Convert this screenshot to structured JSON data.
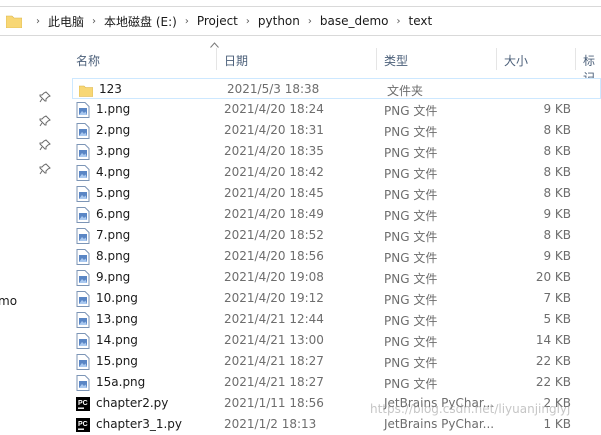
{
  "address": {
    "crumbs": [
      "此电脑",
      "本地磁盘 (E:)",
      "Project",
      "python",
      "base_demo",
      "text"
    ],
    "separator": "›"
  },
  "nav": {
    "partial_label": "mo"
  },
  "header": {
    "name": "名称",
    "date": "日期",
    "type": "类型",
    "size": "大小",
    "tags": "标记"
  },
  "files": [
    {
      "name": "123",
      "date": "2021/5/3 18:38",
      "type": "文件夹",
      "size": "",
      "icon": "folder-icon"
    },
    {
      "name": "1.png",
      "date": "2021/4/20 18:24",
      "type": "PNG 文件",
      "size": "9 KB",
      "icon": "png-file-icon"
    },
    {
      "name": "2.png",
      "date": "2021/4/20 18:31",
      "type": "PNG 文件",
      "size": "8 KB",
      "icon": "png-file-icon"
    },
    {
      "name": "3.png",
      "date": "2021/4/20 18:35",
      "type": "PNG 文件",
      "size": "8 KB",
      "icon": "png-file-icon"
    },
    {
      "name": "4.png",
      "date": "2021/4/20 18:42",
      "type": "PNG 文件",
      "size": "8 KB",
      "icon": "png-file-icon"
    },
    {
      "name": "5.png",
      "date": "2021/4/20 18:45",
      "type": "PNG 文件",
      "size": "8 KB",
      "icon": "png-file-icon"
    },
    {
      "name": "6.png",
      "date": "2021/4/20 18:49",
      "type": "PNG 文件",
      "size": "9 KB",
      "icon": "png-file-icon"
    },
    {
      "name": "7.png",
      "date": "2021/4/20 18:52",
      "type": "PNG 文件",
      "size": "8 KB",
      "icon": "png-file-icon"
    },
    {
      "name": "8.png",
      "date": "2021/4/20 18:56",
      "type": "PNG 文件",
      "size": "9 KB",
      "icon": "png-file-icon"
    },
    {
      "name": "9.png",
      "date": "2021/4/20 19:08",
      "type": "PNG 文件",
      "size": "20 KB",
      "icon": "png-file-icon"
    },
    {
      "name": "10.png",
      "date": "2021/4/20 19:12",
      "type": "PNG 文件",
      "size": "7 KB",
      "icon": "png-file-icon"
    },
    {
      "name": "13.png",
      "date": "2021/4/21 12:44",
      "type": "PNG 文件",
      "size": "5 KB",
      "icon": "png-file-icon"
    },
    {
      "name": "14.png",
      "date": "2021/4/21 13:00",
      "type": "PNG 文件",
      "size": "14 KB",
      "icon": "png-file-icon"
    },
    {
      "name": "15.png",
      "date": "2021/4/21 18:27",
      "type": "PNG 文件",
      "size": "22 KB",
      "icon": "png-file-icon"
    },
    {
      "name": "15a.png",
      "date": "2021/4/21 18:27",
      "type": "PNG 文件",
      "size": "22 KB",
      "icon": "png-file-icon"
    },
    {
      "name": "chapter2.py",
      "date": "2021/1/11 18:56",
      "type": "JetBrains PyChar...",
      "size": "2 KB",
      "icon": "pycharm-file-icon"
    },
    {
      "name": "chapter3_1.py",
      "date": "2021/1/2 18:13",
      "type": "JetBrains PyChar...",
      "size": "1 KB",
      "icon": "pycharm-file-icon"
    }
  ],
  "watermark": "https://blog.csdn.net/liyuanjinglyj",
  "colors": {
    "header_text": "#4c607a",
    "folder": "#f8d775",
    "selection_border": "#cde8ff"
  }
}
